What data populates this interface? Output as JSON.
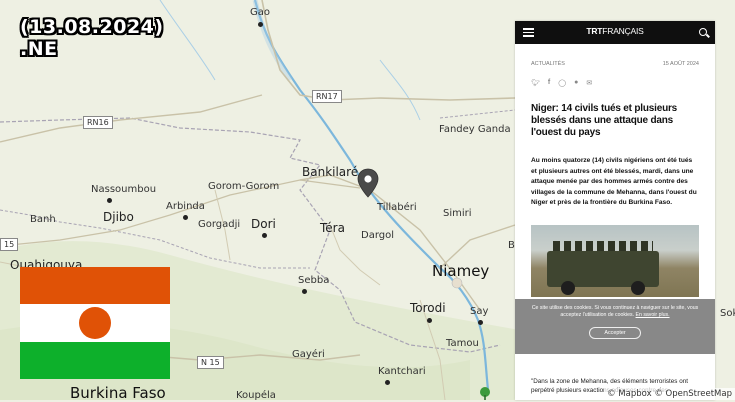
{
  "overlay": {
    "date_line1": "(13.08.2024)",
    "date_line2": ".NE"
  },
  "map": {
    "attribution": "© Mapbox © OpenStreetMap",
    "roads": [
      "RN17",
      "RN16",
      "N 15",
      "15"
    ],
    "places": [
      "Gao",
      "Fandey Ganda",
      "Bankilaré",
      "Tillabéri",
      "Nassoumbou",
      "Gorom-Gorom",
      "Arbinda",
      "Djibo",
      "Banh",
      "Gorgadji",
      "Dori",
      "Téra",
      "Dargol",
      "Simiri",
      "Ouahigouya",
      "Niamey",
      "Sebba",
      "Torodi",
      "Say",
      "Tamou",
      "Gayéri",
      "Kantchari",
      "Burkina Faso",
      "Koupéla",
      "Sok"
    ]
  },
  "flag": {
    "country": "Niger",
    "colors": {
      "top": "#e05206",
      "middle": "#ffffff",
      "bottom": "#0db02b",
      "sun": "#e05206"
    }
  },
  "article": {
    "brand_prefix": "TRT",
    "brand_suffix": "FRANÇAIS",
    "section": "ACTUALITÉS",
    "date": "15 AOÛT 2024",
    "share_icons": [
      "twitter-icon",
      "facebook-icon",
      "whatsapp-icon",
      "reddit-icon",
      "email-icon"
    ],
    "headline": "Niger: 14 civils tués et plusieurs blessés dans une attaque dans l'ouest du pays",
    "summary": "Au moins quatorze (14) civils nigériens ont été tués et plusieurs autres ont été blessés, mardi, dans une attaque menée par des hommes armés contre des villages de la commune de Mehanna, dans l'ouest du Niger et près de la frontière du Burkina Faso.",
    "quote": "\"Dans la zone de Mehanna, des éléments terroristes ont perpétré plusieurs exactions odieuses contre des"
  },
  "cookie": {
    "text": "Ce site utilise des cookies. Si vous continuez à naviguer sur le site, vous acceptez l'utilisation de cookies.",
    "link": "En savoir plus.",
    "accept_label": "Accepter"
  }
}
